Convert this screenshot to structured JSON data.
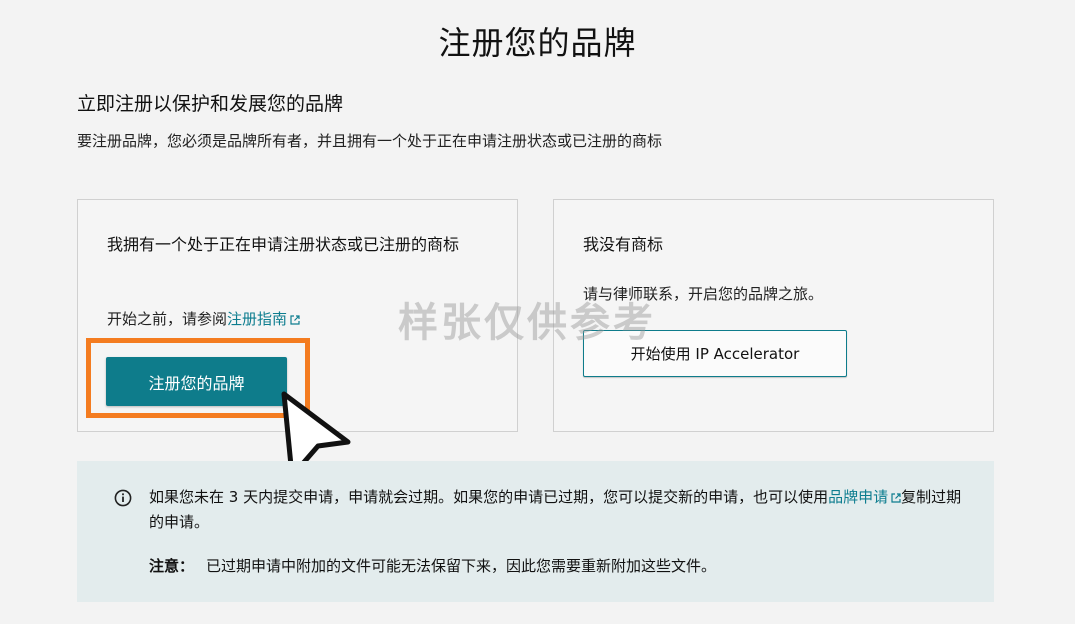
{
  "page": {
    "title": "注册您的品牌",
    "subheading": "立即注册以保护和发展您的品牌",
    "intro": "要注册品牌，您必须是品牌所有者，并且拥有一个处于正在申请注册状态或已注册的商标"
  },
  "card_left": {
    "heading": "我拥有一个处于正在申请注册状态或已注册的商标",
    "guide_prefix": "开始之前，请参阅",
    "guide_link": "注册指南",
    "button_label": "注册您的品牌"
  },
  "card_right": {
    "heading": "我没有商标",
    "text": "请与律师联系，开启您的品牌之旅。",
    "button_label": "开始使用 IP Accelerator"
  },
  "info": {
    "text_part1": "如果您未在 3 天内提交申请，申请就会过期。如果您的申请已过期，您可以提交新的申请，也可以使用",
    "link": "品牌申请",
    "text_part2": "复制过期的申请。",
    "note_label": "注意：",
    "note_text": "已过期申请中附加的文件可能无法保留下来，因此您需要重新附加这些文件。"
  },
  "watermark": "样张仅供参考",
  "colors": {
    "accent": "#0e7c8b",
    "link": "#0d7d8f",
    "highlight": "#f47c20",
    "info_bg": "#e3eced"
  },
  "icons": {
    "external_link": "external-link-icon",
    "info": "info-circle-icon",
    "cursor": "mouse-cursor-icon"
  }
}
